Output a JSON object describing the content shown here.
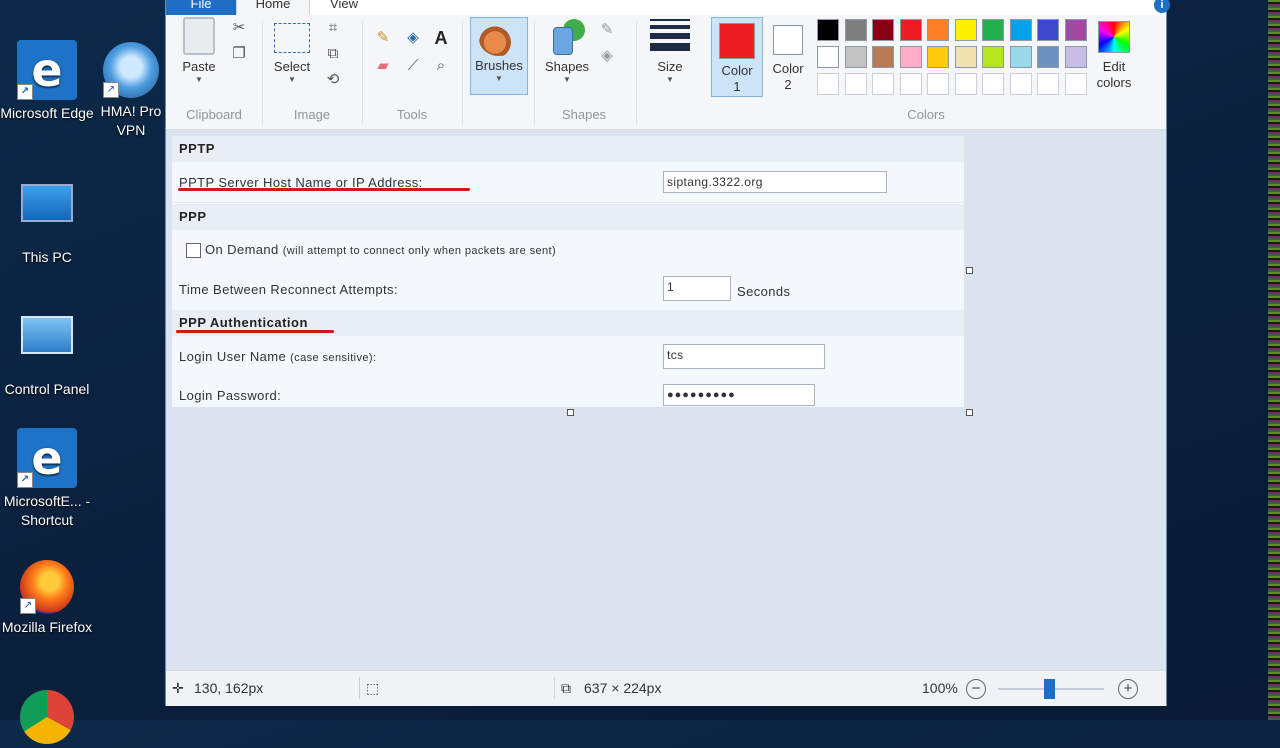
{
  "desktop": {
    "icons": [
      {
        "label": "Microsoft Edge"
      },
      {
        "label": "HMA! Pro VPN"
      },
      {
        "label": "This PC"
      },
      {
        "label": "Control Panel"
      },
      {
        "label": "MicrosoftE... - Shortcut"
      },
      {
        "label": "Mozilla Firefox"
      },
      {
        "label": ""
      }
    ]
  },
  "paint": {
    "tabs": {
      "file": "File",
      "home": "Home",
      "view": "View"
    },
    "ribbon": {
      "paste": "Paste",
      "select": "Select",
      "brushes": "Brushes",
      "shapes": "Shapes",
      "size": "Size",
      "color1": "Color 1",
      "color2": "Color 2",
      "edit_colors": "Edit colors",
      "groups": {
        "clipboard": "Clipboard",
        "image": "Image",
        "tools": "Tools",
        "shapes": "Shapes",
        "colors": "Colors"
      }
    },
    "colors": {
      "color1": "#ed1c24",
      "color2": "#ffffff",
      "row1": [
        "#000000",
        "#7f7f7f",
        "#880015",
        "#ed1c24",
        "#ff7f27",
        "#fff200",
        "#22b14c",
        "#00a2e8",
        "#3f48cc",
        "#a349a4"
      ],
      "row2": [
        "#ffffff",
        "#c3c3c3",
        "#b97a57",
        "#ffaec9",
        "#ffc90e",
        "#efe4b0",
        "#b5e61d",
        "#99d9ea",
        "#7092be",
        "#c8bfe7"
      ]
    },
    "form": {
      "pptp_header": "PPTP",
      "pptp_label": "PPTP Server Host Name or IP Address:",
      "pptp_value": "siptang.3322.org",
      "ppp_header": "PPP",
      "on_demand_label": "On Demand",
      "on_demand_note": "(will attempt to connect only when packets are sent)",
      "reconnect_label": "Time Between Reconnect Attempts:",
      "reconnect_value": "1",
      "reconnect_unit": "Seconds",
      "auth_header": "PPP Authentication",
      "user_label": "Login User Name",
      "user_note": "(case sensitive):",
      "user_value": "tcs",
      "pass_label": "Login Password:",
      "pass_value": "●●●●●●●●●"
    },
    "status": {
      "cursor_pos": "130, 162px",
      "image_size": "637 × 224px",
      "zoom": "100%"
    }
  }
}
